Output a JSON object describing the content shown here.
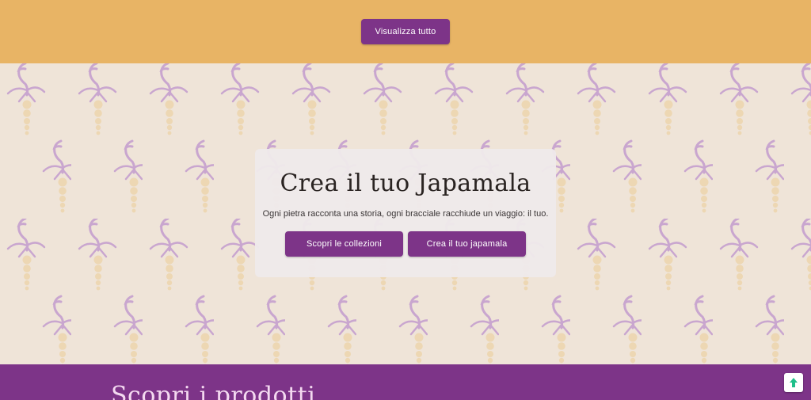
{
  "top_section": {
    "view_all_label": "Visualizza tutto"
  },
  "hero": {
    "title": "Crea il tuo Japamala",
    "subtitle": "Ogni pietra racconta una storia, ogni bracciale racchiude un viaggio: il tuo.",
    "buttons": [
      {
        "label": "Scopri le collezioni"
      },
      {
        "label": "Crea il tuo japamala"
      }
    ]
  },
  "products_section": {
    "title": "Scopri i prodotti"
  },
  "icons": {
    "pattern": "bird-bead-pattern-icon",
    "scroll_top": "arrow-up-icon"
  },
  "colors": {
    "accent_purple": "#7d3488",
    "top_band": "#e8b465",
    "pattern_background": "#efe4d8",
    "pattern_bird": "#c9a6cf",
    "pattern_beads": "#edd7b3",
    "scroll_top_arrow": "#1fbf8a"
  }
}
